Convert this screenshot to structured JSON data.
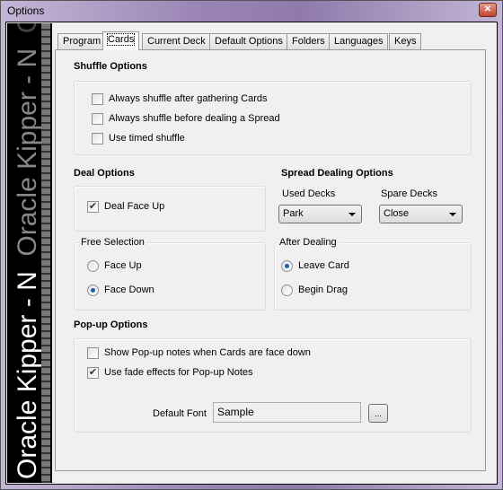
{
  "window": {
    "title": "Options",
    "close_icon": "close-icon"
  },
  "banner": {
    "text_primary": "Oracle Kipper - N",
    "text_secondary": "Oracle Kipper - N",
    "text_tertiary": "Oracl"
  },
  "tabs": [
    {
      "label": "Program"
    },
    {
      "label": "Cards",
      "selected": true
    },
    {
      "label": "Current Deck"
    },
    {
      "label": "Default Options"
    },
    {
      "label": "Folders"
    },
    {
      "label": "Languages"
    },
    {
      "label": "Keys"
    }
  ],
  "shuffle": {
    "heading": "Shuffle Options",
    "items": [
      {
        "label": "Always shuffle after gathering Cards",
        "checked": false
      },
      {
        "label": "Always shuffle before dealing a Spread",
        "checked": false
      },
      {
        "label": "Use timed shuffle",
        "checked": false
      }
    ]
  },
  "deal": {
    "heading": "Deal Options",
    "face_up": {
      "label": "Deal Face Up",
      "checked": true,
      "mark": "✔"
    }
  },
  "spread": {
    "heading": "Spread Dealing Options",
    "used_label": "Used Decks",
    "used_value": "Park",
    "spare_label": "Spare Decks",
    "spare_value": "Close"
  },
  "free_selection": {
    "legend": "Free Selection",
    "options": [
      {
        "label": "Face Up",
        "selected": false
      },
      {
        "label": "Face Down",
        "selected": true
      }
    ]
  },
  "after_dealing": {
    "legend": "After Dealing",
    "options": [
      {
        "label": "Leave Card",
        "selected": true
      },
      {
        "label": "Begin Drag",
        "selected": false
      }
    ]
  },
  "popup": {
    "heading": "Pop-up Options",
    "items": [
      {
        "label": "Show Pop-up notes when Cards are face down",
        "checked": false
      },
      {
        "label": "Use fade effects for Pop-up Notes",
        "checked": true,
        "mark": "✔"
      }
    ],
    "font_label": "Default Font",
    "font_value": "Sample",
    "browse_label": "..."
  }
}
